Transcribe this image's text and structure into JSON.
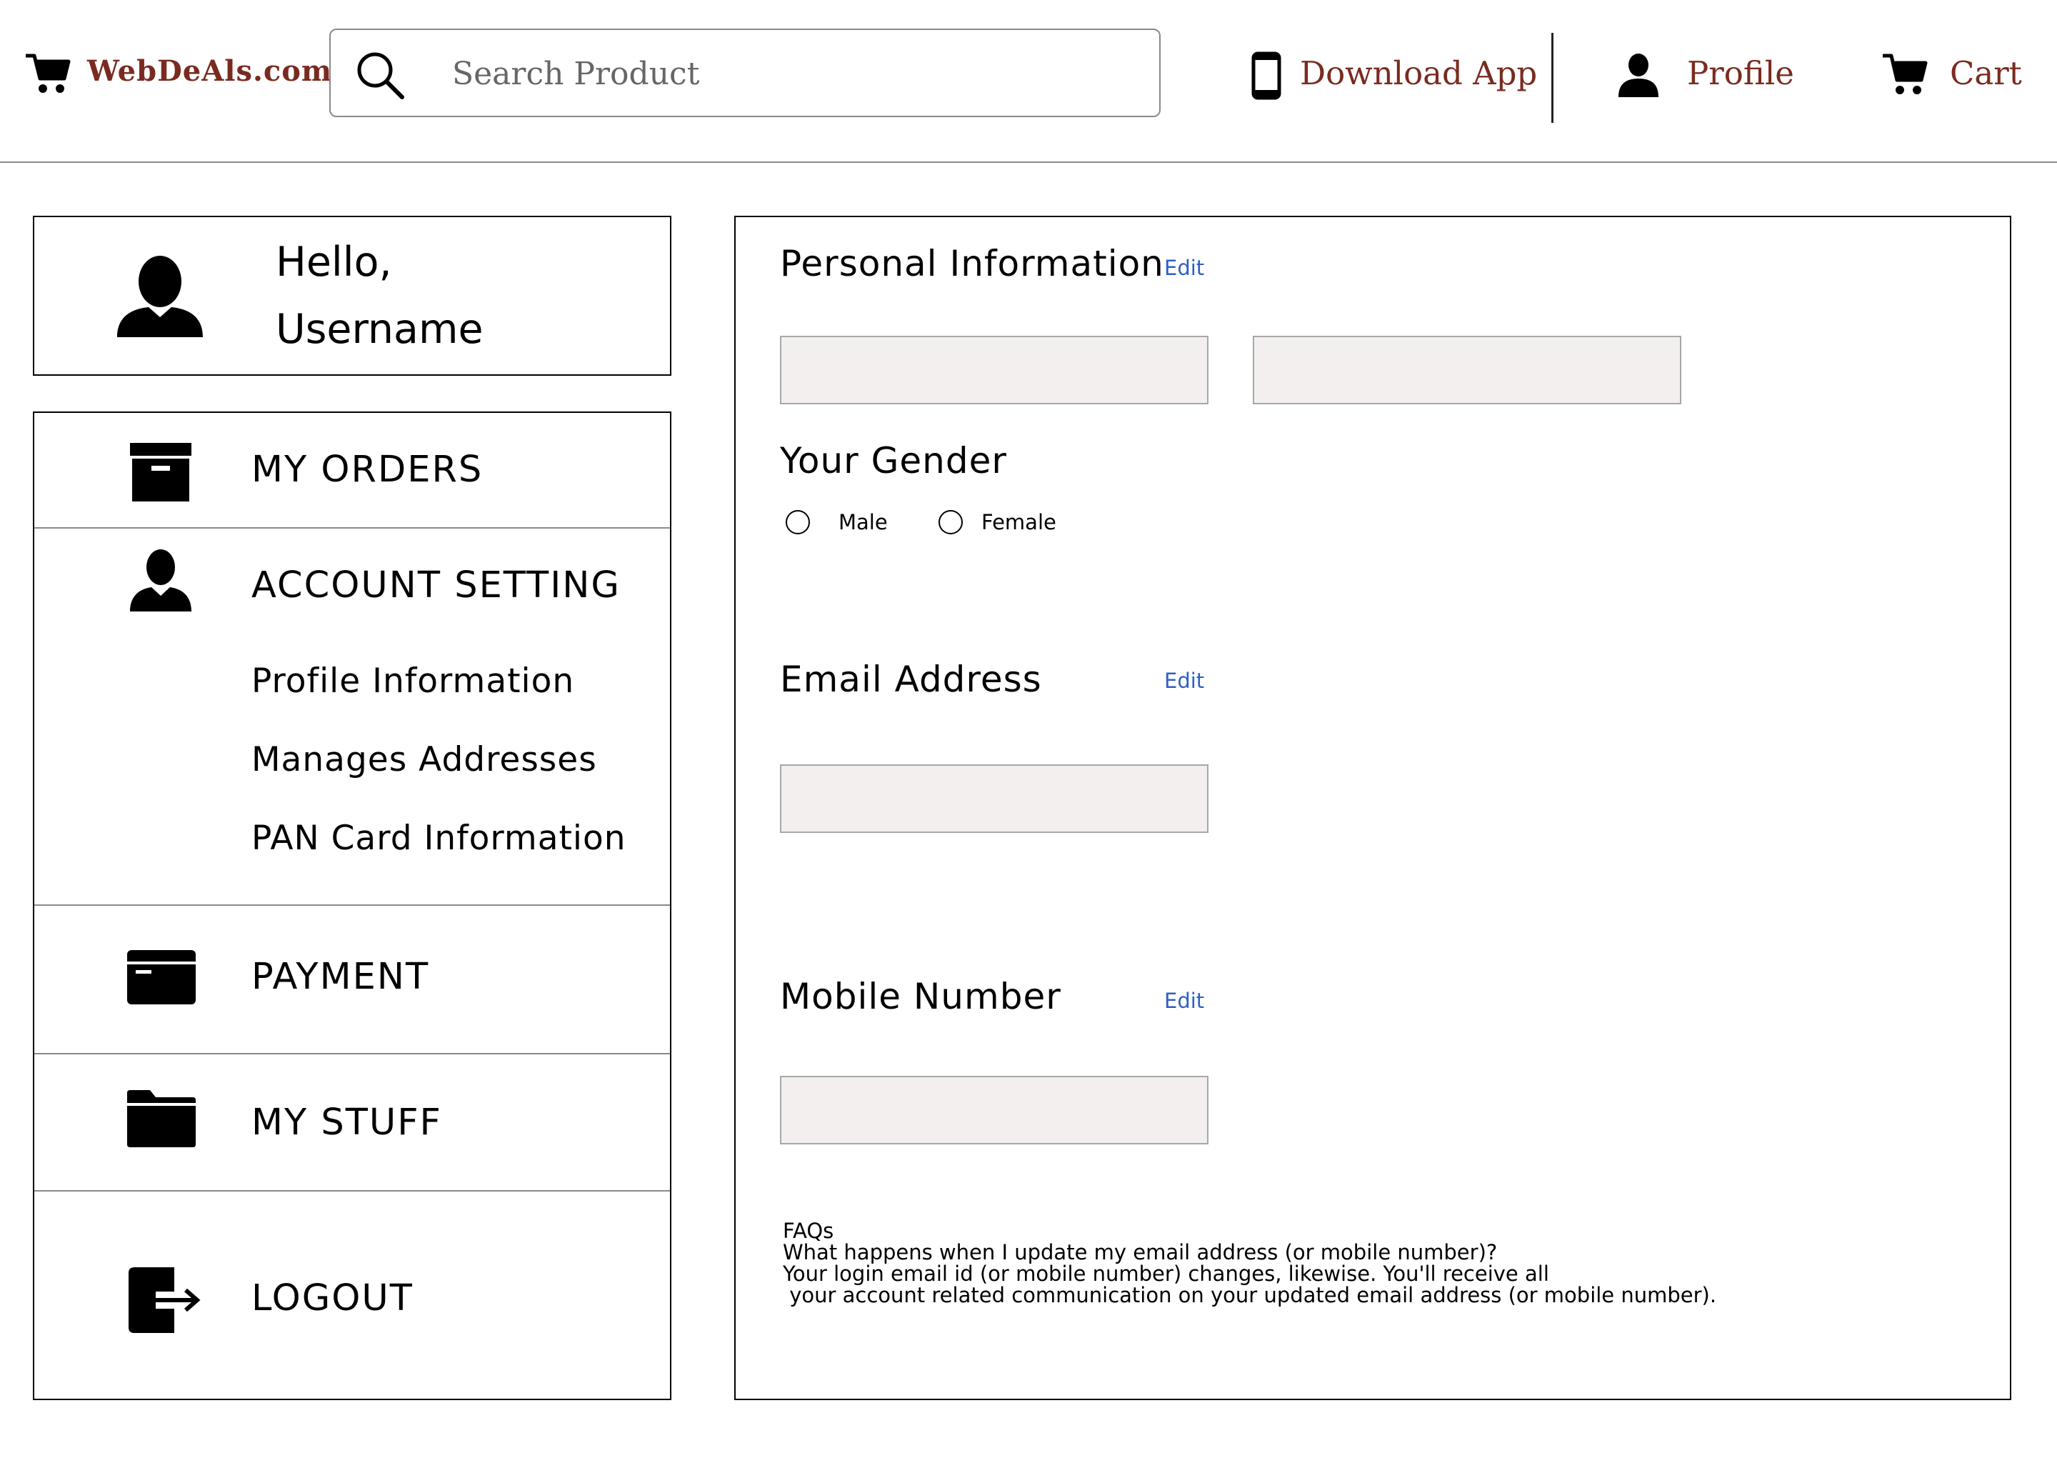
{
  "header": {
    "logo_text": "WebDeAls.com",
    "search": {
      "placeholder": "Search Product"
    },
    "download_app_label": "Download App",
    "profile_label": "Profile",
    "cart_label": "Cart"
  },
  "sidebar": {
    "greeting_line1": "Hello,",
    "greeting_line2": "Username",
    "menu": {
      "my_orders": "MY ORDERS",
      "account_setting": "ACCOUNT SETTING",
      "profile_information": "Profile Information",
      "manage_addresses": "Manages Addresses",
      "pan_card_information": "PAN Card Information",
      "payment": "PAYMENT",
      "my_stuff": "MY STUFF",
      "logout": "LOGOUT"
    }
  },
  "main": {
    "personal_info": {
      "title": "Personal Information",
      "edit_label": "Edit",
      "first_name_value": "",
      "last_name_value": ""
    },
    "gender": {
      "title": "Your Gender",
      "options": [
        "Male",
        "Female"
      ],
      "selected": ""
    },
    "email": {
      "title": "Email Address",
      "edit_label": "Edit",
      "value": ""
    },
    "mobile": {
      "title": "Mobile Number",
      "edit_label": "Edit",
      "value": ""
    },
    "faq": {
      "heading": "FAQs",
      "question": "What happens when I update my email address (or mobile number)?",
      "answer_line1": "Your login email id (or mobile number) changes, likewise. You'll receive all",
      "answer_line2": " your account related communication on your updated email address (or mobile number)."
    }
  },
  "colors": {
    "brand": "#7a2b20",
    "link": "#2f5fc4",
    "field_bg": "#f2efee",
    "border": "#000000"
  }
}
